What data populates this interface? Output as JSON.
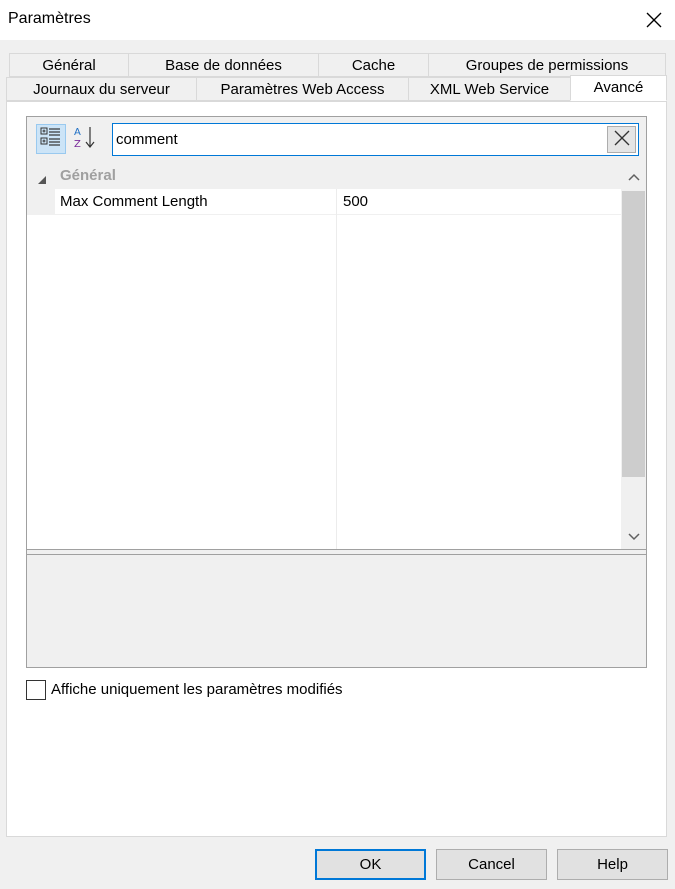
{
  "window": {
    "title": "Paramètres",
    "close_icon": "close-icon"
  },
  "tabs": {
    "row1": [
      "Général",
      "Base de données",
      "Cache",
      "Groupes de permissions"
    ],
    "row2": [
      "Journaux du serveur",
      "Paramètres Web Access",
      "XML Web Service",
      "Avancé"
    ],
    "active": "Avancé"
  },
  "property_grid": {
    "toolbar": {
      "categorized_icon": "categorized-view-icon",
      "alphabetical_icon": "sort-alphabetical-icon"
    },
    "search": {
      "value": "comment",
      "clear_icon": "clear-search-icon"
    },
    "category": {
      "label": "Général",
      "expanded": true
    },
    "properties": [
      {
        "name": "Max Comment Length",
        "value": "500"
      }
    ]
  },
  "options": {
    "show_modified_only_label": "Affiche uniquement les paramètres modifiés",
    "show_modified_only_checked": false
  },
  "buttons": {
    "ok": "OK",
    "cancel": "Cancel",
    "help": "Help"
  },
  "colors": {
    "accent": "#0078d7",
    "selected_tool": "#cce4f7"
  }
}
